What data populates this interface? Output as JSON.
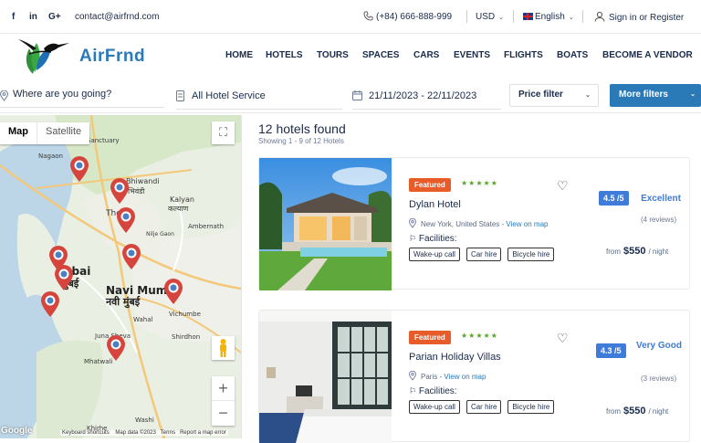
{
  "topbar": {
    "socials": [
      {
        "icon": "facebook-icon",
        "glyph": "f"
      },
      {
        "icon": "linkedin-icon",
        "glyph": "in"
      },
      {
        "icon": "google-plus-icon",
        "glyph": "G+"
      }
    ],
    "email": "contact@airfrnd.com",
    "phone": "(+84) 666-888-999",
    "currency": "USD",
    "language": "English",
    "account": "Sign in or Register"
  },
  "brand": {
    "name": "AirFrnd",
    "logo_icon": "hummingbird-logo-icon"
  },
  "nav": [
    "HOME",
    "HOTELS",
    "TOURS",
    "SPACES",
    "CARS",
    "EVENTS",
    "FLIGHTS",
    "BOATS",
    "BECOME A VENDOR"
  ],
  "search": {
    "destination": "Where are you going?",
    "service": "All Hotel Service",
    "dates": "21/11/2023 - 22/11/2023",
    "price_filter": "Price filter",
    "more_filters": "More filters"
  },
  "map": {
    "tabs": [
      "Map",
      "Satellite"
    ],
    "attribution": [
      "Keyboard shortcuts",
      "Map data ©2023",
      "Terms",
      "Report a map error"
    ],
    "google": "Google",
    "labels": [
      {
        "text": "Bhiwandi"
      },
      {
        "text": "भिवंडी"
      },
      {
        "text": "Kalyan"
      },
      {
        "text": "कल्याण"
      },
      {
        "text": "Ambernath"
      },
      {
        "text": "Nagaon"
      },
      {
        "text": "Sanctuary"
      },
      {
        "text": "Nilje Gaon"
      },
      {
        "text": "Navi Mumb"
      },
      {
        "text": "नवी मुंबई"
      },
      {
        "text": "mbai"
      },
      {
        "text": "मुंबई"
      },
      {
        "text": "Vichumbe"
      },
      {
        "text": "Wahal"
      },
      {
        "text": "Shirdhon"
      },
      {
        "text": "Juna Sheva"
      },
      {
        "text": "Mhatwali"
      },
      {
        "text": "Washi"
      },
      {
        "text": "Khirhe"
      },
      {
        "text": "The"
      }
    ]
  },
  "results": {
    "title": "12 hotels found",
    "subtitle": "Showing 1 - 9 of 12 Hotels",
    "facilities_label": "Facilities:",
    "from_label": "from",
    "per_night": "/ night",
    "hotels": [
      {
        "badge": "Featured",
        "stars": "★★★★★",
        "name": "Dylan Hotel",
        "location": "New York, United States",
        "map_link": "View on map",
        "tags": [
          "Wake-up call",
          "Car hire",
          "Bicycle hire"
        ],
        "score": "4.5 /5",
        "rating": "Excellent",
        "reviews": "(4 reviews)",
        "price": "$550"
      },
      {
        "badge": "Featured",
        "stars": "★★★★★",
        "name": "Parian Holiday Villas",
        "location": "Paris",
        "map_link": "View on map",
        "tags": [
          "Wake-up call",
          "Car hire",
          "Bicycle hire"
        ],
        "score": "4.3 /5",
        "rating": "Very Good",
        "reviews": "(3 reviews)",
        "price": "$550"
      }
    ]
  },
  "colors": {
    "accent": "#2a7ab8",
    "featured": "#e85c2a",
    "stars": "#5aa62a",
    "score": "#3f7bd9"
  }
}
